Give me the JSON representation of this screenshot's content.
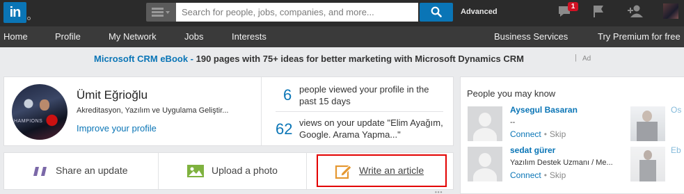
{
  "topbar": {
    "logo_text": "in",
    "search_placeholder": "Search for people, jobs, companies, and more...",
    "advanced_label": "Advanced",
    "notification_count": "1"
  },
  "nav": {
    "items": [
      "Home",
      "Profile",
      "My Network",
      "Jobs",
      "Interests"
    ],
    "business": "Business Services",
    "premium": "Try Premium for free"
  },
  "ad": {
    "link": "Microsoft CRM eBook -",
    "text": "190 pages with 75+ ideas for better marketing with Microsoft Dynamics CRM",
    "label": "Ad"
  },
  "profile": {
    "name": "Ümit Eğrioğlu",
    "headline": "Akreditasyon, Yazılım ve Uygulama Geliştir...",
    "improve_link": "Improve your profile",
    "stats": [
      {
        "number": "6",
        "text": "people viewed your profile in the past 15 days"
      },
      {
        "number": "62",
        "text": "views on your update \"Elim Ayağım, Google. Arama Yapma...\""
      }
    ]
  },
  "share": {
    "update": "Share an update",
    "photo": "Upload a photo",
    "article": "Write an article"
  },
  "pymk": {
    "title": "People you may know",
    "people": [
      {
        "name": "Aysegul Basaran",
        "headline": "--",
        "connect": "Connect",
        "skip": "Skip"
      },
      {
        "name": "sedat gürer",
        "headline": "Yazılım Destek Uzmanı / Me...",
        "connect": "Connect",
        "skip": "Skip"
      }
    ],
    "partial": [
      "Os",
      "Eb"
    ]
  },
  "colors": {
    "brand": "#0a75b6",
    "highlight": "#e30000",
    "badge": "#d11124"
  }
}
